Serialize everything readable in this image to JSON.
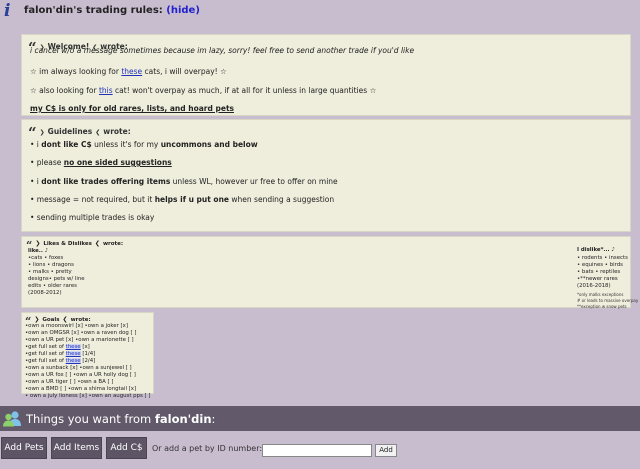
{
  "header": {
    "title": "falon'din's trading rules:",
    "hide_link": "(hide)"
  },
  "welcome": {
    "head": "Welcome!",
    "wrote": "wrote:",
    "line1": "i cancel w/o a message sometimes because im lazy, sorry! feel free to send another trade if you'd like",
    "line2_a": "☆ im always looking for",
    "line2_link": "these",
    "line2_b": "cats, i will overpay! ☆",
    "line3_a": "☆ also looking for",
    "line3_link": "this",
    "line3_b": "cat! won't overpay as much, if at all for it unless in large quantities ☆",
    "line4": "my C$ is only for old rares, lists, and hoard pets"
  },
  "guidelines": {
    "head": "Guidelines",
    "wrote": "wrote:",
    "l1_a": "• i",
    "l1_b": "dont like C$",
    "l1_c": "unless it's for my",
    "l1_d": "uncommons and below",
    "l2_a": "• please",
    "l2_b": "no one sided suggestions",
    "l3_a": "• i",
    "l3_b": "dont like trades offering items",
    "l3_c": "unless WL, however ur free to offer on mine",
    "l4_a": "• message = not required, but it",
    "l4_b": "helps if u put one",
    "l4_c": "when sending a suggestion",
    "l5": "• sending multiple trades is okay"
  },
  "likes": {
    "head": "Likes & Dislikes",
    "wrote": "wrote:",
    "like_title": "like.. ♪",
    "like_lines": [
      "•cats • foxes",
      "• lions • dragons",
      "• malks • pretty",
      "designs• pets w/ line",
      "edits • older rares",
      "(2008-2012)"
    ],
    "dislike_title": "I dislike*... ♪",
    "dislike_lines": [
      "• rodents • insects",
      "• equines • birds",
      "• bats • reptiles",
      "•**newer rares",
      "(2016-2018)"
    ],
    "dislike_notes": [
      "*only malks exceptions",
      "# or leads to massive overpay",
      "**exception w snow pets"
    ]
  },
  "goals": {
    "head": "Goals",
    "wrote": "wrote:",
    "lines": [
      {
        "a": "•own a moonswirl [x] •own a joker [x]"
      },
      {
        "a": "•own an OMGSR [x] •own a raven dog [ ]"
      },
      {
        "a": "•own a UR pet [x] •own a marionette [ ]"
      },
      {
        "a": "•get full set of",
        "link": "these",
        "b": "[x]"
      },
      {
        "a": "•get full set of",
        "link": "these",
        "b": "[1/4]"
      },
      {
        "a": "•get full set of",
        "link": "these",
        "b": "[2/4]"
      },
      {
        "a": "•own a sunback [x] •own a sunjewel [ ]"
      },
      {
        "a": "•own a UR fox [ ] •own a UR holly dog [ ]"
      },
      {
        "a": "•own a UR tiger [ ] •own a BA [ ]"
      },
      {
        "a": "•own a BMD [ ] •own a shima longtail [x]"
      },
      {
        "a": "• own a july lioness [x] •own an august pps [ ]"
      }
    ]
  },
  "things_bar": {
    "prefix": "Things you want from",
    "user": "falon'din",
    "suffix": ":"
  },
  "buttons": {
    "add_pets": "Add Pets",
    "add_items": "Add Items",
    "add_cs": "Add C$",
    "id_label": "Or add a pet by ID number:",
    "id_value": "",
    "add": "Add"
  }
}
